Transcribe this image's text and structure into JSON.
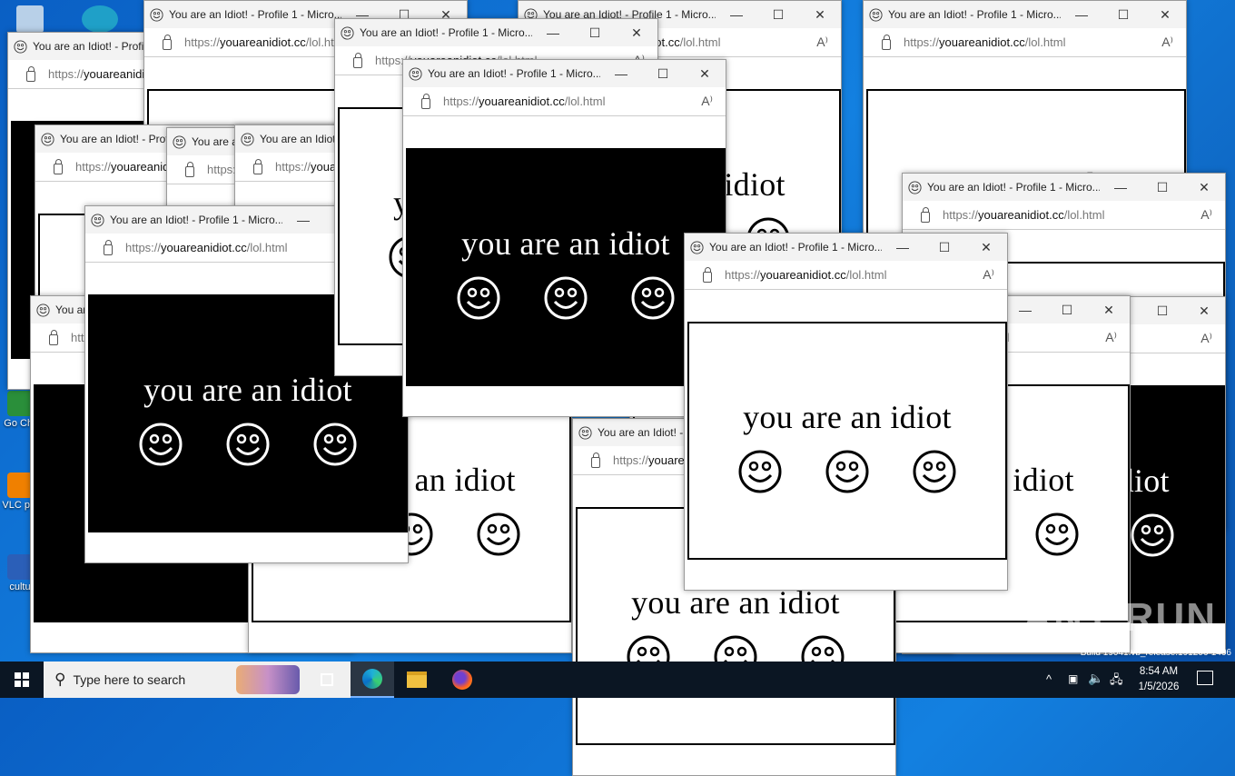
{
  "desktop": {
    "icons": [
      {
        "label": "Go Chr",
        "icon": "chrome-icon"
      },
      {
        "label": "VLC pla",
        "icon": "vlc-icon"
      },
      {
        "label": "cultu",
        "icon": "word-doc-icon"
      }
    ],
    "watermark": "ANY RUN",
    "build": "Build 19041.vb_release.191206-1406"
  },
  "window": {
    "title": "You are an Idiot! - Profile 1 - Micro...",
    "url_scheme": "https://",
    "url_domain": "youareanidiot.cc",
    "url_path": "/lol.html",
    "message": "you are an idiot",
    "minimize": "—",
    "maximize": "☐",
    "close": "✕",
    "read_aloud": "A⁾"
  },
  "taskbar": {
    "search_placeholder": "Type here to search",
    "time": "8:54 AM",
    "date": "1/5/2026",
    "tray_chevron": "^"
  }
}
